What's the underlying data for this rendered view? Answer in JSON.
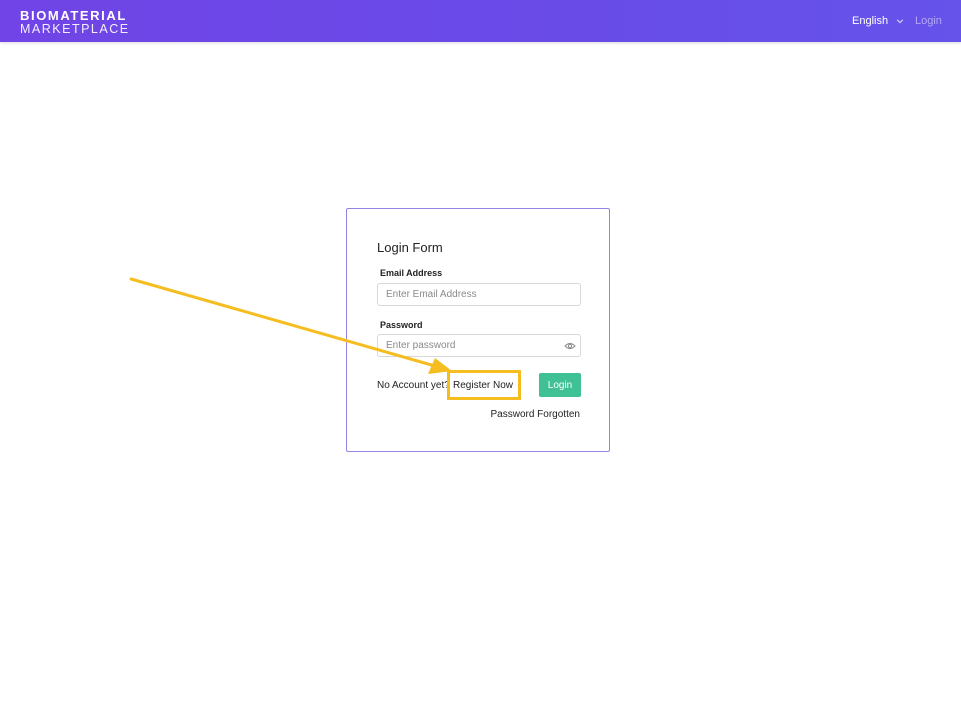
{
  "header": {
    "logo_line1": "BIOMATERIAL",
    "logo_line2": "MARKETPLACE",
    "language_label": "English",
    "login_link": "Login"
  },
  "login_form": {
    "title": "Login Form",
    "email_label": "Email Address",
    "email_placeholder": "Enter Email Address",
    "password_label": "Password",
    "password_placeholder": "Enter password",
    "no_account_text": "No Account yet?",
    "register_link": "Register Now",
    "login_button": "Login",
    "forgot_link": "Password Forgotten"
  },
  "annotation": {
    "color": "#f5bd1f",
    "target": "register-now-link"
  },
  "colors": {
    "header_gradient_start": "#7044e6",
    "header_gradient_end": "#6553ea",
    "card_border": "#8f86e6",
    "login_button": "#3fc195"
  },
  "icons": {
    "language_dropdown": "chevron-down-icon",
    "password_toggle": "eye-icon"
  }
}
